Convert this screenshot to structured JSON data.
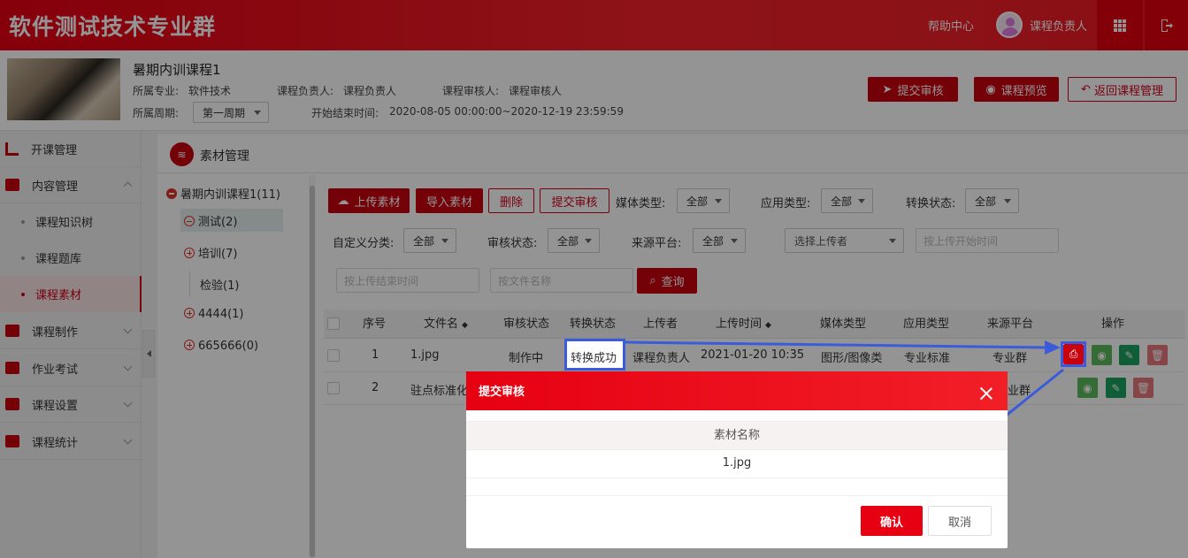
{
  "header": {
    "logo": "软件测试技术专业群",
    "help": "帮助中心",
    "user": "课程负责人"
  },
  "course": {
    "title": "暑期内训课程1",
    "major_label": "所属专业:",
    "major": "软件技术",
    "owner_label": "课程负责人:",
    "owner": "课程负责人",
    "reviewer_label": "课程审核人:",
    "reviewer": "课程审核人",
    "period_label": "所属周期:",
    "period": "第一周期",
    "time_label": "开始结束时间:",
    "time": "2020-08-05 00:00:00~2020-12-19 23:59:59",
    "btn_submit": "提交审核",
    "btn_preview": "课程预览",
    "btn_return": "返回课程管理"
  },
  "sidebar": {
    "items": [
      {
        "label": "开课管理"
      },
      {
        "label": "内容管理"
      },
      {
        "label": "课程知识树"
      },
      {
        "label": "课程题库"
      },
      {
        "label": "课程素材"
      },
      {
        "label": "课程制作"
      },
      {
        "label": "作业考试"
      },
      {
        "label": "课程设置"
      },
      {
        "label": "课程统计"
      }
    ]
  },
  "section": {
    "title": "素材管理"
  },
  "tree": {
    "root": "暑期内训课程1(11)",
    "nodes": [
      "测试(2)",
      "培训(7)",
      "检验(1)",
      "4444(1)",
      "665666(0)"
    ]
  },
  "toolbar": {
    "upload": "上传素材",
    "import": "导入素材",
    "delete": "删除",
    "submit": "提交审核",
    "media_label": "媒体类型:",
    "media": "全部",
    "app_label": "应用类型:",
    "app": "全部",
    "conv_label": "转换状态:",
    "conv": "全部",
    "custom_label": "自定义分类:",
    "custom": "全部",
    "review_label": "审核状态:",
    "review": "全部",
    "source_label": "来源平台:",
    "source": "全部",
    "uploader_placeholder": "选择上传者",
    "start_placeholder": "按上传开始时间",
    "end_placeholder": "按上传结束时间",
    "name_placeholder": "按文件名称",
    "query": "查询"
  },
  "table": {
    "headers": [
      "序号",
      "文件名",
      "审核状态",
      "转换状态",
      "上传者",
      "上传时间",
      "媒体类型",
      "应用类型",
      "来源平台",
      "操作"
    ],
    "rows": [
      {
        "no": "1",
        "name": "1.jpg",
        "review": "制作中",
        "conv": "转换成功",
        "uploader": "课程负责人",
        "time": "2021-01-20 10:35",
        "media": "图形/图像类",
        "app": "专业标准",
        "source": "专业群"
      },
      {
        "no": "2",
        "name": "驻点标准化",
        "source": "业群"
      }
    ]
  },
  "modal": {
    "title": "提交审核",
    "col_header": "素材名称",
    "item": "1.jpg",
    "confirm": "确认",
    "cancel": "取消"
  },
  "colors": {
    "brand": "#e60012",
    "dark_red": "#c9030e",
    "green": "#2ea44f",
    "highlight": "#3b5bdb"
  }
}
